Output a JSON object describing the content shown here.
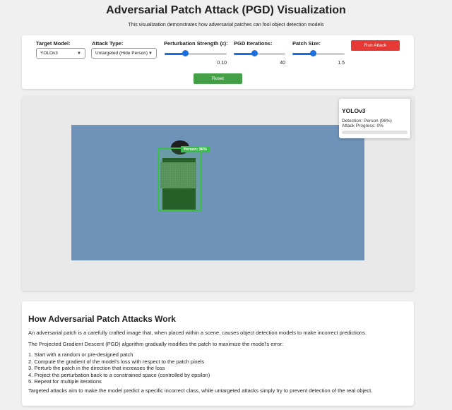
{
  "header": {
    "title": "Adversarial Patch Attack (PGD) Visualization",
    "subtitle": "This visualization demonstrates how adversarial patches can fool object detection models"
  },
  "controls": {
    "target_model": {
      "label": "Target Model:",
      "value": "YOLOv3"
    },
    "attack_type": {
      "label": "Attack Type:",
      "value": "Untargeted (Hide Person)"
    },
    "perturbation": {
      "label": "Perturbation Strength (ε):",
      "value": "0.10",
      "fraction": 0.33
    },
    "iterations": {
      "label": "PGD Iterations:",
      "value": "40",
      "fraction": 0.41
    },
    "patch_size": {
      "label": "Patch Size:",
      "value": "1.5",
      "fraction": 0.4
    },
    "run_label": "Run Attack",
    "reset_label": "Reset"
  },
  "visualization": {
    "detection_label": "Person: 96%",
    "info": {
      "model": "YOLOv3",
      "detection": "Detection: Person (96%)",
      "progress_text": "Attack Progress: 0%",
      "progress": 0
    }
  },
  "explanation": {
    "title": "How Adversarial Patch Attacks Work",
    "intro": "An adversarial patch is a carefully crafted image that, when placed within a scene, causes object detection models to make incorrect predictions.",
    "pgd": "The Projected Gradient Descent (PGD) algorithm gradually modifies the patch to maximize the model's error:",
    "steps": [
      "1. Start with a random or pre-designed patch",
      "2. Compute the gradient of the model's loss with respect to the patch pixels",
      "3. Perturb the patch in the direction that increases the loss",
      "4. Project the perturbation back to a constrained space (controlled by epsilon)",
      "5. Repeat for multiple iterations"
    ],
    "outro": "Targeted attacks aim to make the model predict a specific incorrect class, while untargeted attacks simply try to prevent detection of the real object."
  },
  "colors": {
    "accent": "#1b6fe0",
    "run_button": "#e53935",
    "reset_button": "#43a047",
    "detection_box": "#3bbd4a",
    "scene_background": "#6f93b8"
  }
}
